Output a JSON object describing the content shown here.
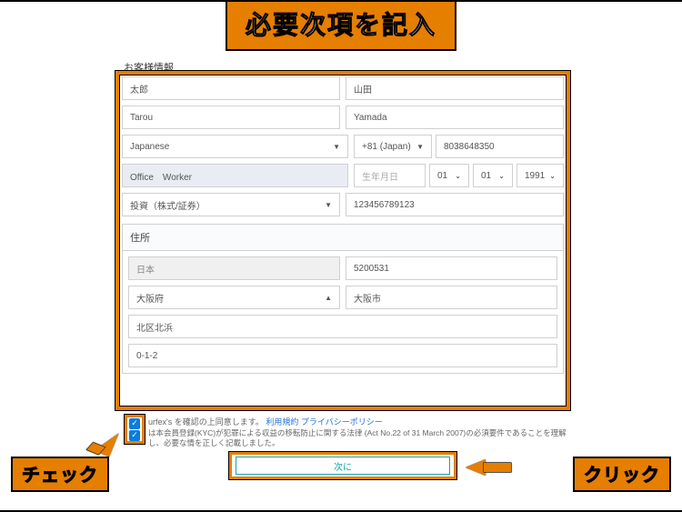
{
  "banner": "必要次項を記入",
  "section_title": "お客様情報",
  "name": {
    "first_jp": "太郎",
    "last_jp": "山田",
    "first_en": "Tarou",
    "last_en": "Yamada"
  },
  "nationality": {
    "value": "Japanese"
  },
  "phone": {
    "cc": "+81 (Japan)",
    "number": "8038648350"
  },
  "occupation": {
    "value": "Office　Worker"
  },
  "dob": {
    "label": "生年月日",
    "day": "01",
    "month": "01",
    "year": "1991"
  },
  "purpose": {
    "value": "投資（株式/証券）"
  },
  "idnum": "123456789123",
  "address": {
    "header": "住所",
    "country": "日本",
    "postal": "5200531",
    "prefecture": "大阪府",
    "city": "大阪市",
    "ward": "北区北浜",
    "line": "0-1-2"
  },
  "check1": {
    "pre": "urfex's を確認の上同意します。",
    "link1": "利用規約",
    "link2": "プライバシーポリシー"
  },
  "check2": "は本会員登録(KYC)が犯罪による収益の移転防止に関する法律 (Act No.22 of 31 March 2007)の必須要件であることを理解し、必要な情を正しく記載しました。",
  "submit": "次に",
  "labels": {
    "check": "チェック",
    "click": "クリック"
  }
}
